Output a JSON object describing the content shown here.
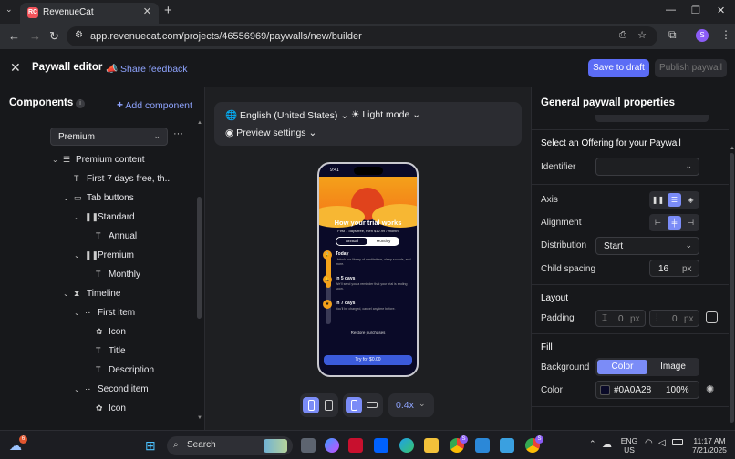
{
  "browser": {
    "tab_title": "RevenueCat",
    "tab_favicon": "RC",
    "url": "app.revenuecat.com/projects/46556969/paywalls/new/builder",
    "profile_initial": "S"
  },
  "header": {
    "title": "Paywall editor",
    "share_feedback": "Share feedback",
    "save_draft": "Save to draft",
    "publish": "Publish paywall"
  },
  "components": {
    "title": "Components",
    "add_label": "Add component",
    "selected_package": "Premium",
    "tree": [
      {
        "label": "Premium content",
        "depth": 0,
        "chevron": "⌄",
        "icon": "☰"
      },
      {
        "label": "First 7 days free, th...",
        "depth": 1,
        "chevron": "",
        "icon": "T"
      },
      {
        "label": "Tab buttons",
        "depth": 1,
        "chevron": "⌄",
        "icon": "▭"
      },
      {
        "label": "Standard",
        "depth": 2,
        "chevron": "⌄",
        "icon": "❚❚"
      },
      {
        "label": "Annual",
        "depth": 3,
        "chevron": "",
        "icon": "T"
      },
      {
        "label": "Premium",
        "depth": 2,
        "chevron": "⌄",
        "icon": "❚❚"
      },
      {
        "label": "Monthly",
        "depth": 3,
        "chevron": "",
        "icon": "T"
      },
      {
        "label": "Timeline",
        "depth": 1,
        "chevron": "⌄",
        "icon": "⧗"
      },
      {
        "label": "First item",
        "depth": 2,
        "chevron": "⌄",
        "icon": "·-"
      },
      {
        "label": "Icon",
        "depth": 3,
        "chevron": "",
        "icon": "✿"
      },
      {
        "label": "Title",
        "depth": 3,
        "chevron": "",
        "icon": "T"
      },
      {
        "label": "Description",
        "depth": 3,
        "chevron": "",
        "icon": "T"
      },
      {
        "label": "Second item",
        "depth": 2,
        "chevron": "⌄",
        "icon": "·-"
      },
      {
        "label": "Icon",
        "depth": 3,
        "chevron": "",
        "icon": "✿"
      }
    ]
  },
  "preview_toolbar": {
    "language": "English (United States)",
    "mode": "Light mode",
    "preview_settings": "Preview settings"
  },
  "phone_preview": {
    "time": "9:41",
    "heading": "How your trial works",
    "subheading": "First 7 days free, then $12.99 / month",
    "tab_annual": "Annual",
    "tab_monthly": "Monthly",
    "timeline": [
      {
        "title": "Today",
        "description": "Unlock our library of meditations, sleep sounds, and more."
      },
      {
        "title": "In 5 days",
        "description": "We'll send you a reminder that your trial is ending soon."
      },
      {
        "title": "In 7 days",
        "description": "You'll be charged, cancel anytime before."
      }
    ],
    "restore": "Restore purchases",
    "cta": "Try for $0.00"
  },
  "zoom": "0.4x",
  "properties": {
    "title": "General paywall properties",
    "offering_heading": "Select an Offering for your Paywall",
    "identifier_label": "Identifier",
    "identifier_value": "",
    "axis_label": "Axis",
    "alignment_label": "Alignment",
    "distribution_label": "Distribution",
    "distribution_value": "Start",
    "child_spacing_label": "Child spacing",
    "child_spacing_value": "16",
    "unit_px": "px",
    "layout_heading": "Layout",
    "padding_label": "Padding",
    "padding_v": "0",
    "padding_h": "0",
    "fill_heading": "Fill",
    "background_label": "Background",
    "bg_color_tab": "Color",
    "bg_image_tab": "Image",
    "color_label": "Color",
    "color_value": "#0A0A28",
    "opacity": "100%",
    "swatch": "#0A0A28",
    "accent": "#7b8cf7"
  },
  "taskbar": {
    "weather_badge": "6",
    "search": "Search",
    "chrome_badge": "S",
    "lang_top": "ENG",
    "lang_bottom": "US",
    "time": "11:17 AM",
    "date": "7/21/2025"
  }
}
